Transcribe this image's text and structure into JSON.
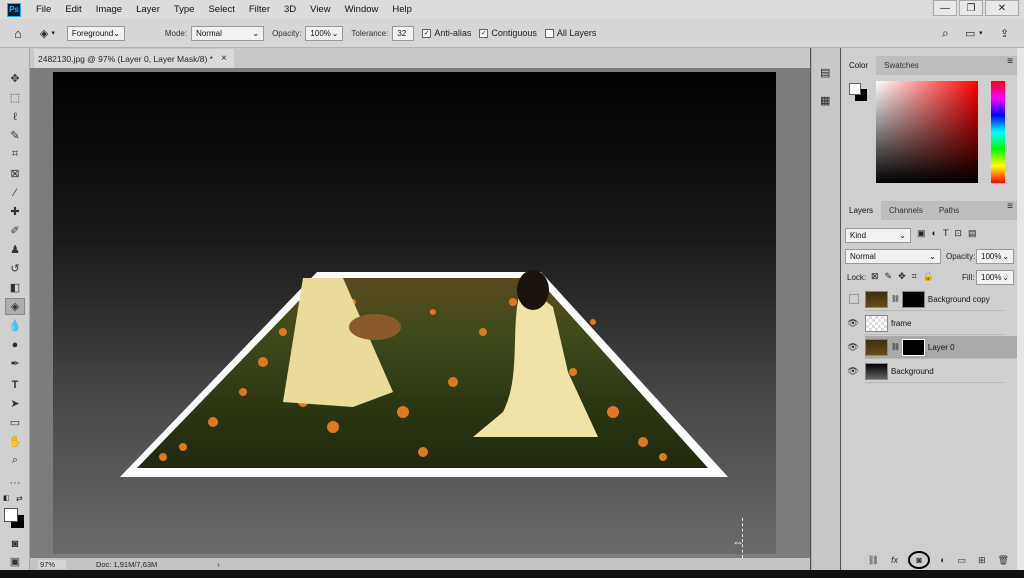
{
  "menu": {
    "logo": "Ps",
    "items": [
      "File",
      "Edit",
      "Image",
      "Layer",
      "Type",
      "Select",
      "Filter",
      "3D",
      "View",
      "Window",
      "Help"
    ]
  },
  "window_controls": {
    "minimize": "—",
    "restore": "❐",
    "close": "✕"
  },
  "options": {
    "fill_source": "Foreground",
    "mode_label": "Mode:",
    "mode_value": "Normal",
    "opacity_label": "Opacity:",
    "opacity_value": "100%",
    "tolerance_label": "Tolerance:",
    "tolerance_value": "32",
    "anti_alias": "Anti-alias",
    "contiguous": "Contiguous",
    "all_layers": "All Layers"
  },
  "document": {
    "tab_title": "2482130.jpg @ 97% (Layer 0, Layer Mask/8) *",
    "close": "×"
  },
  "status": {
    "zoom": "97%",
    "doc_info": "Doc: 1,91M/7,63M",
    "arrow": "›"
  },
  "color_panel": {
    "tabs": [
      "Color",
      "Swatches"
    ],
    "menu_icon": "≡"
  },
  "layers_panel": {
    "tabs": [
      "Layers",
      "Channels",
      "Paths"
    ],
    "kind_label": "Kind",
    "blend_mode": "Normal",
    "opacity_label": "Opacity:",
    "opacity_value": "100%",
    "lock_label": "Lock:",
    "fill_label": "Fill:",
    "fill_value": "100%",
    "layers": [
      {
        "name": "Background copy",
        "visible": false,
        "has_mask": true
      },
      {
        "name": "frame",
        "visible": true,
        "has_mask": false
      },
      {
        "name": "Layer 0",
        "visible": true,
        "has_mask": true,
        "selected": true
      },
      {
        "name": "Background",
        "visible": true,
        "has_mask": false
      }
    ]
  },
  "colors": {
    "accent": "#31a8ff",
    "selected_layer": "#a9a9a9"
  }
}
